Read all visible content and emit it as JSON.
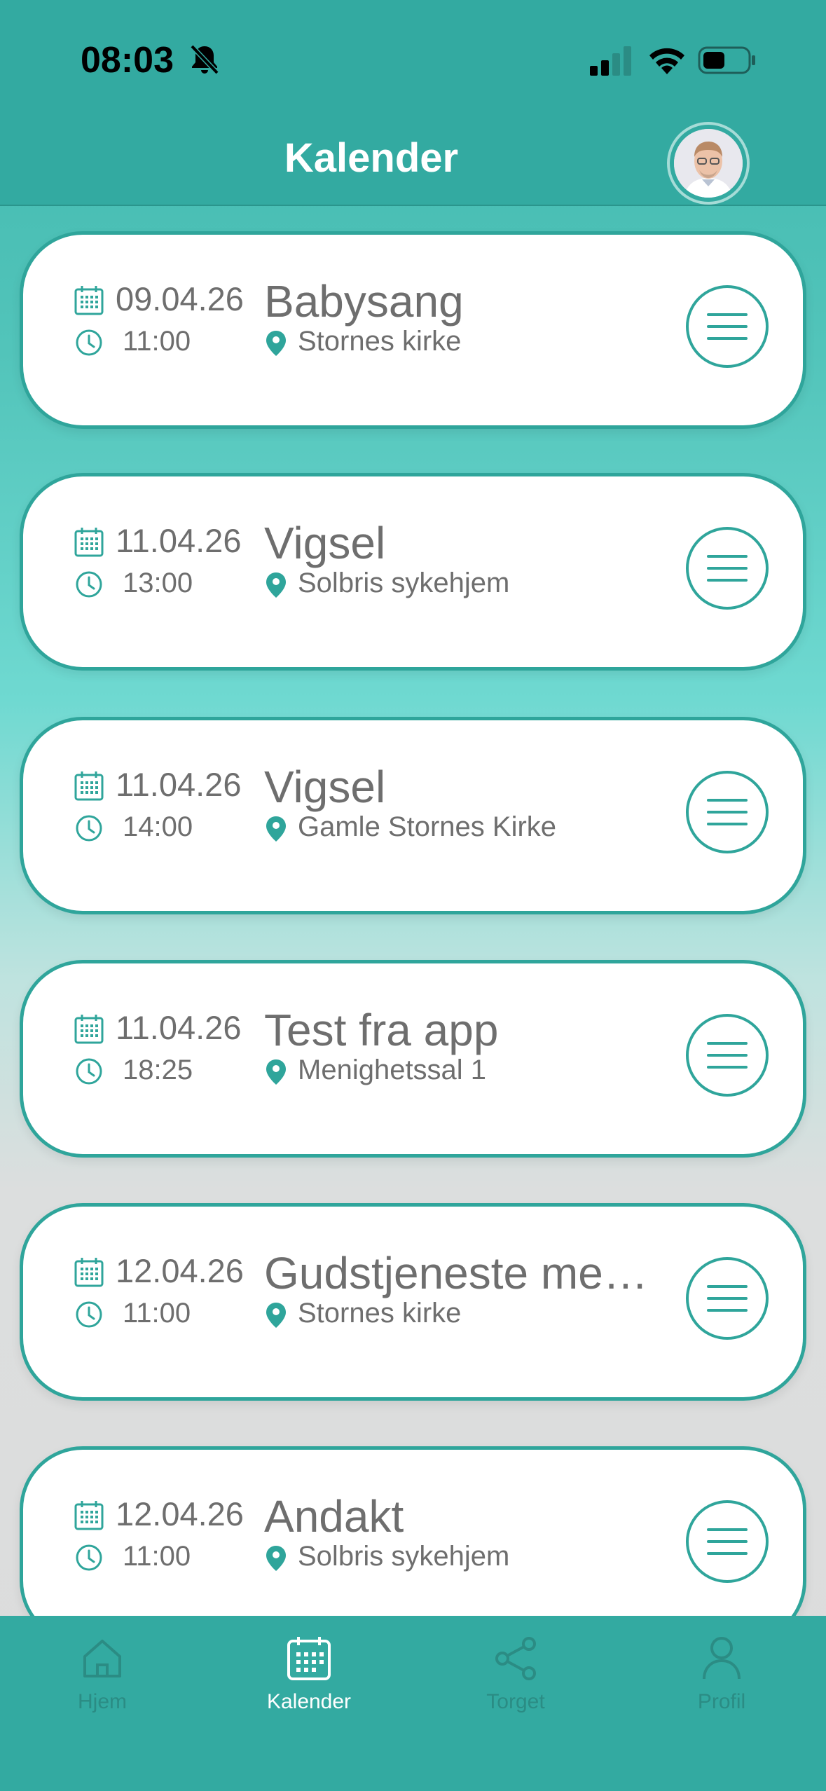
{
  "status_bar": {
    "time": "08:03"
  },
  "header": {
    "title": "Kalender"
  },
  "events": [
    {
      "date": "09.04.26",
      "time": "11:00",
      "title": "Babysang",
      "location": "Stornes kirke"
    },
    {
      "date": "11.04.26",
      "time": "13:00",
      "title": "Vigsel",
      "location": "Solbris sykehjem"
    },
    {
      "date": "11.04.26",
      "time": "14:00",
      "title": "Vigsel",
      "location": "Gamle Stornes Kirke"
    },
    {
      "date": "11.04.26",
      "time": "18:25",
      "title": "Test fra app",
      "location": "Menighetssal 1"
    },
    {
      "date": "12.04.26",
      "time": "11:00",
      "title": "Gudstjeneste me…",
      "location": "Stornes kirke"
    },
    {
      "date": "12.04.26",
      "time": "11:00",
      "title": "Andakt",
      "location": "Solbris sykehjem"
    }
  ],
  "tabbar": {
    "items": [
      {
        "label": "Hjem",
        "icon": "home-icon",
        "active": false
      },
      {
        "label": "Kalender",
        "icon": "calendar-icon",
        "active": true
      },
      {
        "label": "Torget",
        "icon": "share-icon",
        "active": false
      },
      {
        "label": "Profil",
        "icon": "user-icon",
        "active": false
      }
    ]
  },
  "colors": {
    "accent": "#2fa59b",
    "header_bg": "#33aaa1",
    "text": "#6e6e6e"
  }
}
